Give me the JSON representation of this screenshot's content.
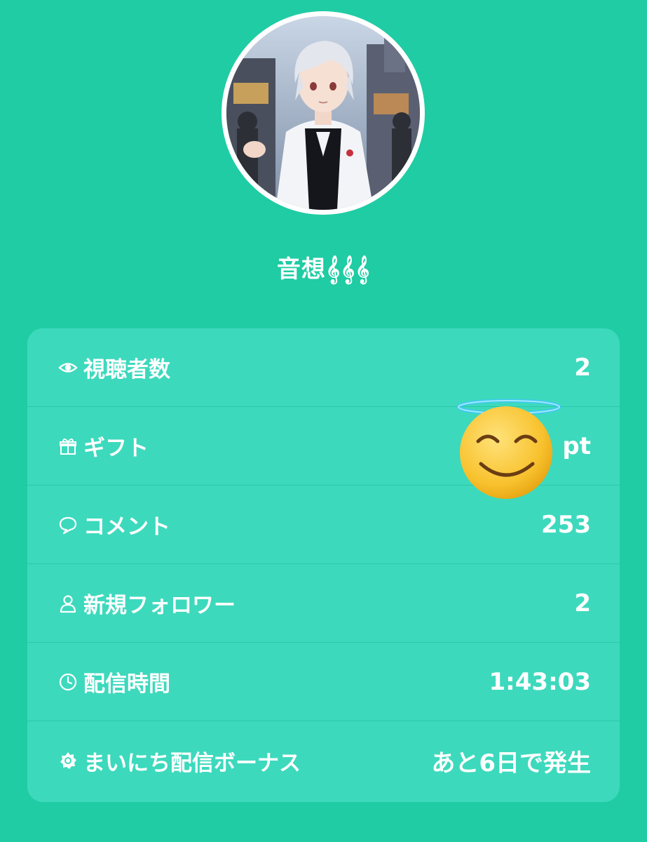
{
  "profile": {
    "username": "音想𝄞𝄞𝄞"
  },
  "stats": {
    "viewers": {
      "label": "視聴者数",
      "value": "2",
      "icon": "eye-icon"
    },
    "gift": {
      "label": "ギフト",
      "value": "pt",
      "icon": "gift-icon"
    },
    "comments": {
      "label": "コメント",
      "value": "253",
      "icon": "comment-icon"
    },
    "new_followers": {
      "label": "新規フォロワー",
      "value": "2",
      "icon": "person-icon"
    },
    "stream_time": {
      "label": "配信時間",
      "value": "1:43:03",
      "icon": "clock-icon"
    },
    "daily_bonus": {
      "label": "まいにち配信ボーナス",
      "value": "あと6日で発生",
      "icon": "sun-icon"
    }
  },
  "colors": {
    "background": "#1fcca4",
    "card": "#3dd9bd",
    "text": "#ffffff"
  }
}
